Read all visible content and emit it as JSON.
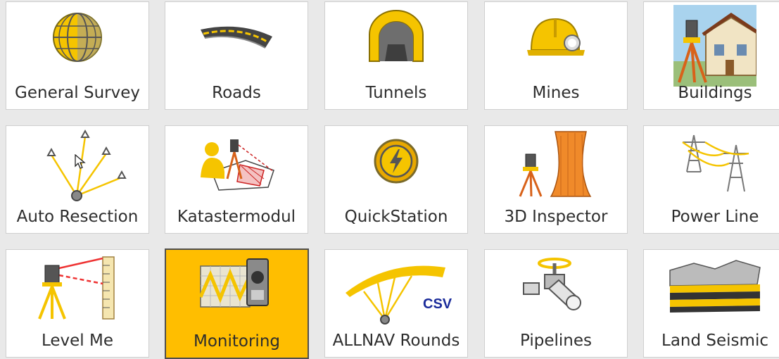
{
  "tiles": [
    {
      "label": "General Survey",
      "icon": "globe-icon"
    },
    {
      "label": "Roads",
      "icon": "road-icon"
    },
    {
      "label": "Tunnels",
      "icon": "tunnel-icon"
    },
    {
      "label": "Mines",
      "icon": "miner-helmet-icon"
    },
    {
      "label": "Buildings",
      "icon": "building-survey-icon"
    },
    {
      "label": "Auto Resection",
      "icon": "resection-icon"
    },
    {
      "label": "Katastermodul",
      "icon": "cadastre-icon"
    },
    {
      "label": "QuickStation",
      "icon": "lightning-icon"
    },
    {
      "label": "3D Inspector",
      "icon": "cooling-tower-icon"
    },
    {
      "label": "Power Line",
      "icon": "power-pylon-icon"
    },
    {
      "label": "Level Me",
      "icon": "level-staff-icon"
    },
    {
      "label": "Monitoring",
      "icon": "monitoring-icon",
      "selected": true
    },
    {
      "label": "ALLNAV Rounds",
      "icon": "allnav-rounds-icon",
      "badge": "CSV"
    },
    {
      "label": "Pipelines",
      "icon": "pipeline-valve-icon"
    },
    {
      "label": "Land Seismic",
      "icon": "seismic-layers-icon"
    }
  ],
  "colors": {
    "accent": "#ffbe00",
    "tile_bg": "#ffffff",
    "page_bg": "#e9e9e9"
  }
}
